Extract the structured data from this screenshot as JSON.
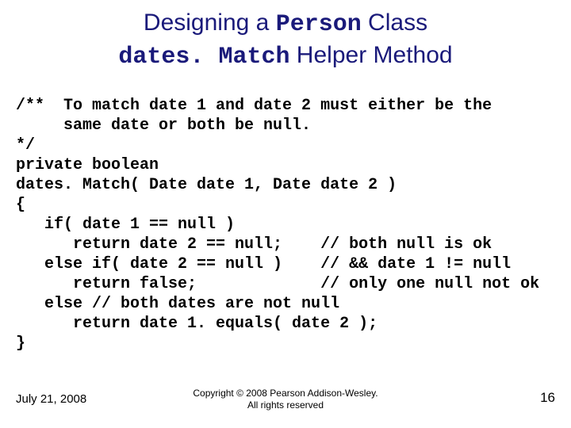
{
  "title": {
    "line1_pre": "Designing a ",
    "line1_mono": "Person",
    "line1_post": " Class",
    "line2_mono": "dates. Match",
    "line2_post": " Helper Method"
  },
  "code": "/**  To match date 1 and date 2 must either be the\n     same date or both be null.\n*/\nprivate boolean\ndates. Match( Date date 1, Date date 2 )\n{\n   if( date 1 == null )\n      return date 2 == null;    // both null is ok\n   else if( date 2 == null )    // && date 1 != null\n      return false;             // only one null not ok\n   else // both dates are not null\n      return date 1. equals( date 2 );\n}",
  "footer": {
    "date": "July 21, 2008",
    "copyright_line1": "Copyright © 2008 Pearson Addison-Wesley.",
    "copyright_line2": "All rights reserved",
    "page": "16"
  }
}
